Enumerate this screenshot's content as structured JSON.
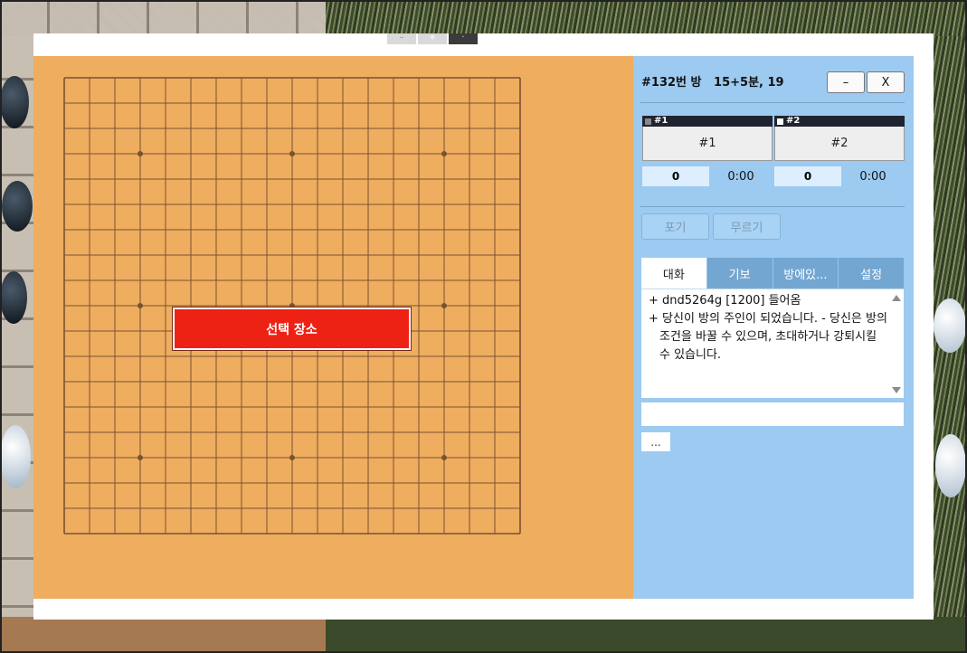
{
  "top_controls": [
    "–",
    "+",
    "·"
  ],
  "overlay": {
    "label": "선택 장소"
  },
  "board": {
    "size": 19,
    "star_points": [
      [
        3,
        3
      ],
      [
        3,
        9
      ],
      [
        3,
        15
      ],
      [
        9,
        3
      ],
      [
        9,
        9
      ],
      [
        9,
        15
      ],
      [
        15,
        3
      ],
      [
        15,
        9
      ],
      [
        15,
        15
      ]
    ]
  },
  "room": {
    "title": "#132번 방   15+5분, 19",
    "minimize_label": "–",
    "close_label": "X"
  },
  "players": [
    {
      "tag": "#1",
      "name": "#1",
      "score": "0",
      "time": "0:00",
      "square_color": "#888888"
    },
    {
      "tag": "#2",
      "name": "#2",
      "score": "0",
      "time": "0:00",
      "square_color": "#ffffff"
    }
  ],
  "actions": {
    "resign": "포기",
    "undo": "무르기"
  },
  "tabs": [
    {
      "label": "대화",
      "active": true
    },
    {
      "label": "기보",
      "active": false
    },
    {
      "label": "방에있...",
      "active": false
    },
    {
      "label": "설정",
      "active": false
    }
  ],
  "chat": {
    "messages": [
      "+ dnd5264g [1200] 들어옴",
      "+ 당신이 방의 주인이 되었습니다. - 당신은 방의 조건을 바꿀 수 있으며, 초대하거나 강퇴시킬 수 있습니다."
    ],
    "input_value": "",
    "more_label": "..."
  },
  "colors": {
    "board": "#efad5f",
    "board_line": "#7a5230",
    "side_panel": "#9ccaf0",
    "overlay_red": "#ee2214",
    "tab_inactive": "#74a6d2"
  }
}
